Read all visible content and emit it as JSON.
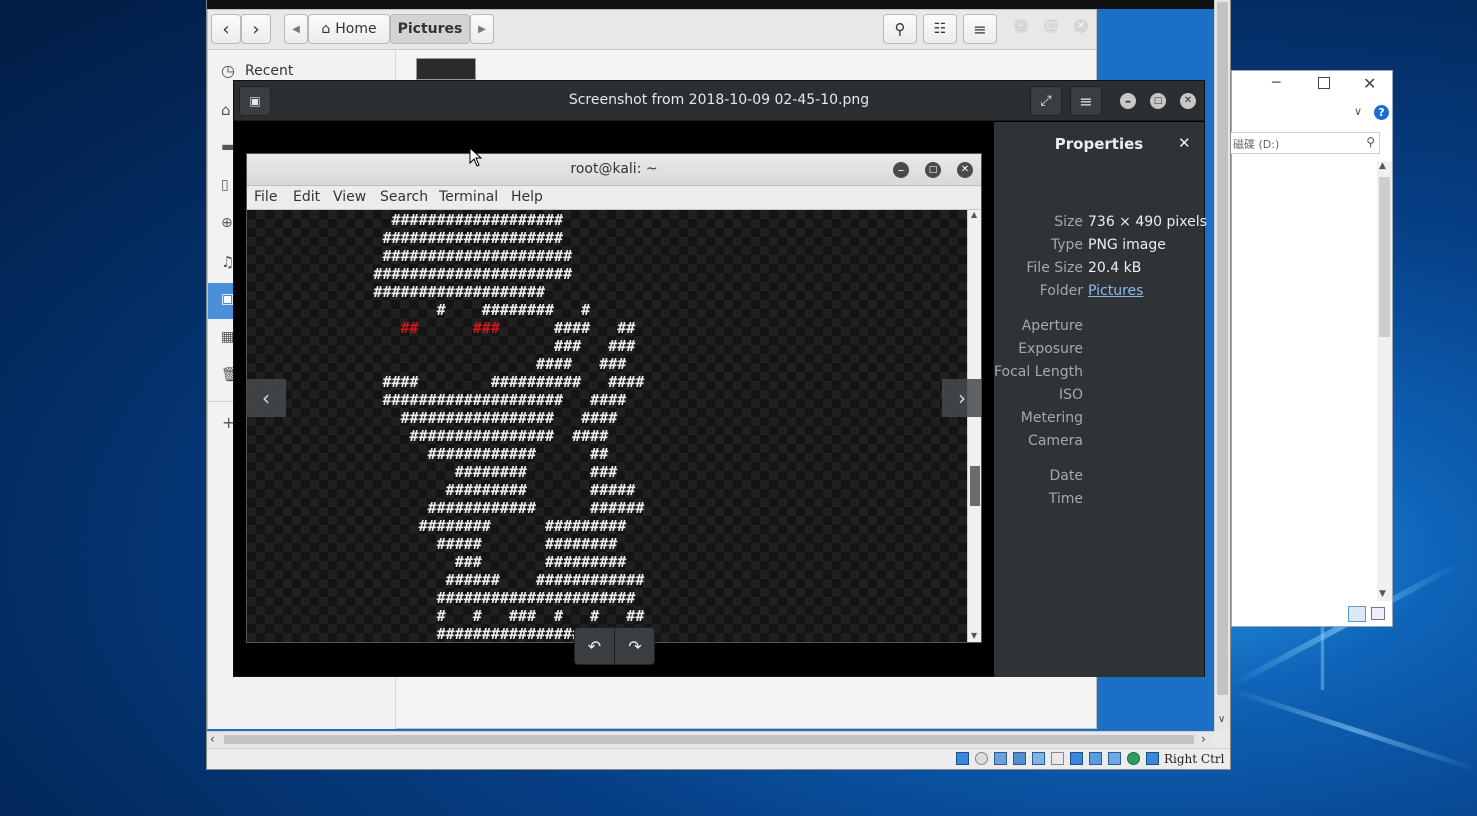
{
  "files": {
    "breadcrumb": {
      "home": "Home",
      "current": "Pictures"
    },
    "sidebar": {
      "first_item": "Recent"
    }
  },
  "viewer": {
    "title": "Screenshot from 2018-10-09 02-45-10.png",
    "properties": {
      "heading": "Properties",
      "rows": [
        {
          "label": "Size",
          "value": "736 × 490 pixels"
        },
        {
          "label": "Type",
          "value": "PNG image"
        },
        {
          "label": "File Size",
          "value": "20.4 kB"
        },
        {
          "label": "Folder",
          "value": "Pictures"
        },
        {
          "label": "Aperture",
          "value": ""
        },
        {
          "label": "Exposure",
          "value": ""
        },
        {
          "label": "Focal Length",
          "value": ""
        },
        {
          "label": "ISO",
          "value": ""
        },
        {
          "label": "Metering",
          "value": ""
        },
        {
          "label": "Camera",
          "value": ""
        },
        {
          "label": "Date",
          "value": ""
        },
        {
          "label": "Time",
          "value": ""
        }
      ]
    }
  },
  "terminal": {
    "title": "root@kali: ~",
    "menu": [
      "File",
      "Edit",
      "View",
      "Search",
      "Terminal",
      "Help"
    ],
    "ascii_lines": [
      "                ###################",
      "               ####################",
      "               #####################",
      "              ######################",
      "              ###################",
      "                     #    ########   #",
      "                 ##      ###      ####   ##",
      "                                  ###   ###",
      "                                ####   ###",
      "               ####        ##########   ####",
      "               ####################   ####",
      "                 #################   ####",
      "                  ################  ####",
      "                    ############      ##",
      "                       ########       ###",
      "                      #########       #####",
      "                    ############      ######",
      "                   ########      #########",
      "                     #####       ########",
      "                       ###       #########",
      "                      ######    ############",
      "                     ######################",
      "                     #   #   ###  #   #   ##",
      "                     ################"
    ]
  },
  "explorer": {
    "address": "磁碟 (D:)"
  },
  "vbox": {
    "host_key": "Right Ctrl"
  }
}
